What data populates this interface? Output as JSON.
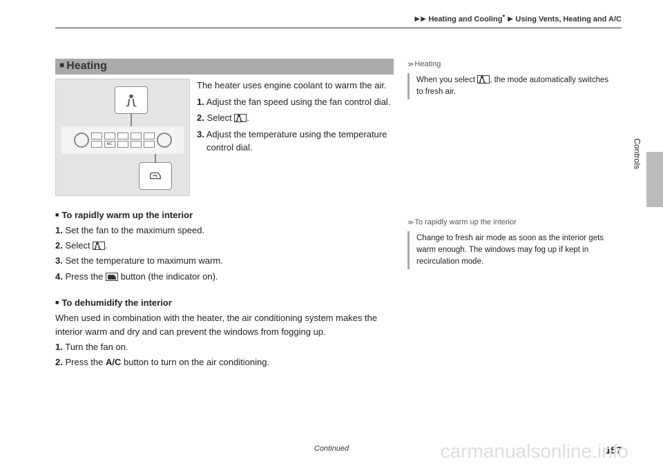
{
  "breadcrumb": {
    "section": "Heating and Cooling",
    "asterisk": "*",
    "subsection": "Using Vents, Heating and A/C"
  },
  "heading": {
    "title": "Heating"
  },
  "intro": {
    "line1": "The heater uses engine coolant to warm the air.",
    "step1": "Adjust the fan speed using the fan control dial.",
    "step2a": "Select ",
    "step2b": ".",
    "step3": "Adjust the temperature using the temperature control dial."
  },
  "sub1": {
    "title": "To rapidly warm up the interior",
    "s1": "Set the fan to the maximum speed.",
    "s2a": "Select ",
    "s2b": ".",
    "s3": "Set the temperature to maximum warm.",
    "s4a": "Press the ",
    "s4b": " button (the indicator on)."
  },
  "sub2": {
    "title": "To dehumidify the interior",
    "p1": "When used in combination with the heater, the air conditioning system makes the interior warm and dry and can prevent the windows from fogging up.",
    "s1": "Turn the fan on.",
    "s2a": "Press the ",
    "s2label": "A/C",
    "s2b": " button to turn on the air conditioning."
  },
  "side1": {
    "head": "Heating",
    "body_a": "When you select ",
    "body_b": ", the mode automatically switches to fresh air."
  },
  "side2": {
    "head": "To rapidly warm up the interior",
    "body": "Change to fresh air mode as soon as the interior gets warm enough. The windows may fog up if kept in recirculation mode."
  },
  "vlabel": "Controls",
  "continued": "Continued",
  "pagenum": "157",
  "watermark": "carmanualsonline.info",
  "icons": {
    "floor": "floor-vent-icon",
    "recirc": "recirculation-icon"
  }
}
